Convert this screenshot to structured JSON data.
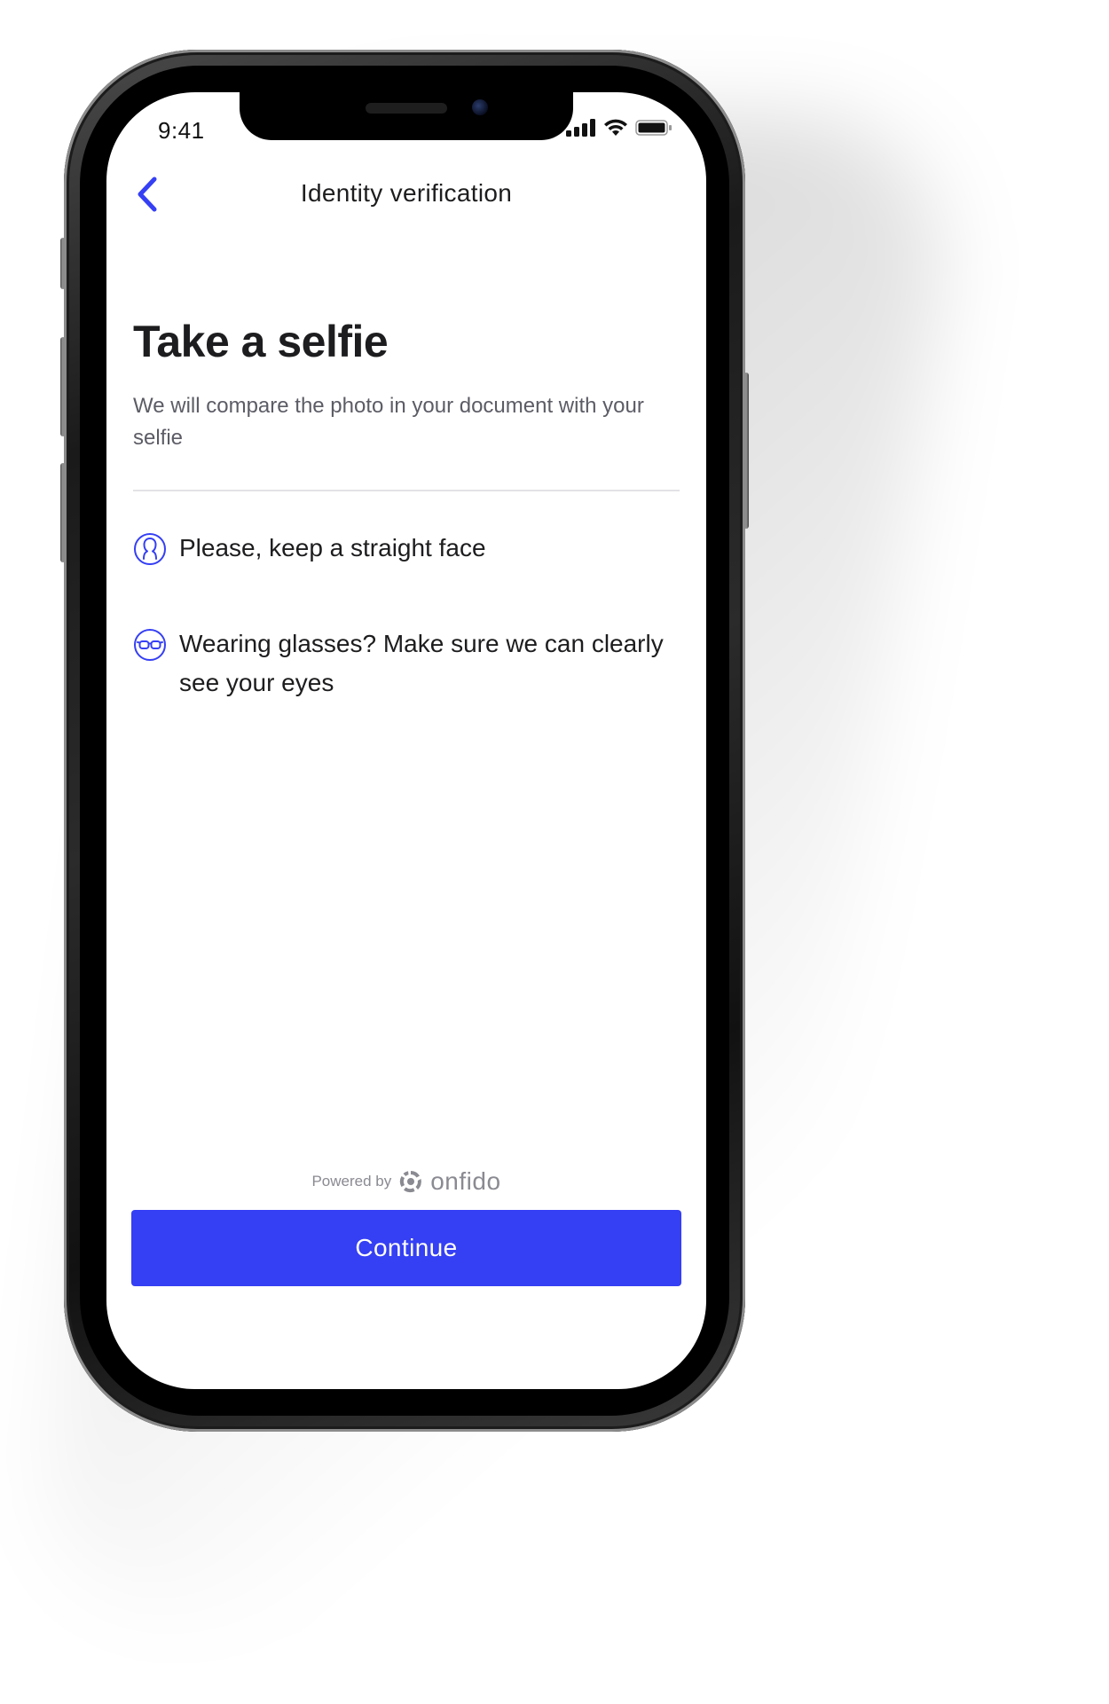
{
  "status_bar": {
    "time": "9:41"
  },
  "nav": {
    "title": "Identity verification",
    "back_icon": "chevron-left-icon"
  },
  "content": {
    "title": "Take a selfie",
    "subtitle": "We will compare the photo in your document with your selfie",
    "tips": [
      {
        "icon": "face-outline-icon",
        "text": "Please, keep a straight face"
      },
      {
        "icon": "glasses-icon",
        "text": "Wearing glasses? Make sure we can clearly see your eyes"
      }
    ]
  },
  "footer": {
    "powered_by": "Powered by",
    "brand": "onfido",
    "continue_label": "Continue"
  },
  "colors": {
    "accent": "#353ff4",
    "text_primary": "#1d1d1f",
    "text_secondary": "#5c5c66",
    "muted": "#8a8a92",
    "background": "#ffffff"
  }
}
